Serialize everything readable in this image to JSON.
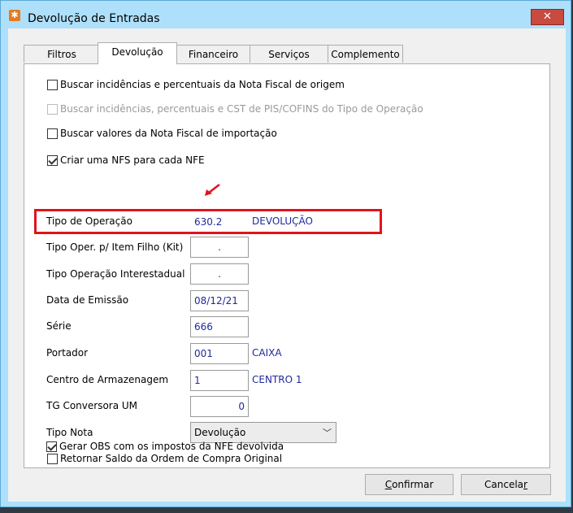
{
  "window": {
    "title": "Devolução de Entradas",
    "close_label": "✕"
  },
  "tabs": [
    {
      "label": "Filtros",
      "active": false
    },
    {
      "label": "Devolução",
      "active": true
    },
    {
      "label": "Financeiro",
      "active": false
    },
    {
      "label": "Serviços",
      "active": false
    },
    {
      "label": "Complemento",
      "active": false
    }
  ],
  "checkboxes": [
    {
      "label": "Buscar incidências e percentuais da Nota Fiscal de origem",
      "checked": false,
      "enabled": true
    },
    {
      "label": "Buscar incidências, percentuais e CST de PIS/COFINS do Tipo de Operação",
      "checked": false,
      "enabled": false
    },
    {
      "label": "Buscar valores da Nota Fiscal de importação",
      "checked": false,
      "enabled": true
    },
    {
      "label": "Criar uma NFS para cada NFE",
      "checked": true,
      "enabled": true
    }
  ],
  "fields": {
    "tipo_operacao": {
      "label": "Tipo de Operação",
      "value": "630.2",
      "desc": "DEVOLUÇÃO"
    },
    "tipo_oper_kit": {
      "label": "Tipo Oper. p/ Item Filho (Kit)",
      "value": "."
    },
    "tipo_op_interestadual": {
      "label": "Tipo Operação Interestadual",
      "value": "."
    },
    "data_emissao": {
      "label": "Data de Emissão",
      "value": "08/12/21"
    },
    "serie": {
      "label": "Série",
      "value": "666"
    },
    "portador": {
      "label": "Portador",
      "value": "001",
      "desc": "CAIXA"
    },
    "centro_armazenagem": {
      "label": "Centro de Armazenagem",
      "value": "1",
      "desc": "CENTRO 1"
    },
    "tg_conversora": {
      "label": "TG Conversora UM",
      "value": "0"
    },
    "tipo_nota": {
      "label": "Tipo Nota",
      "value": "Devolução"
    }
  },
  "bottom_checkboxes": [
    {
      "label": "Retornar Saldo da Ordem de Compra Original",
      "checked": false
    },
    {
      "label": "Gerar OBS com os impostos da NFE devolvida",
      "checked": true
    }
  ],
  "buttons": {
    "confirm": {
      "accel": "C",
      "rest": "onfirmar"
    },
    "cancel": {
      "pre": "Cancela",
      "accel": "r"
    }
  },
  "colors": {
    "highlight": "#e0141b",
    "value_text": "#1f2a9b",
    "window_frame": "#aee0fb"
  }
}
